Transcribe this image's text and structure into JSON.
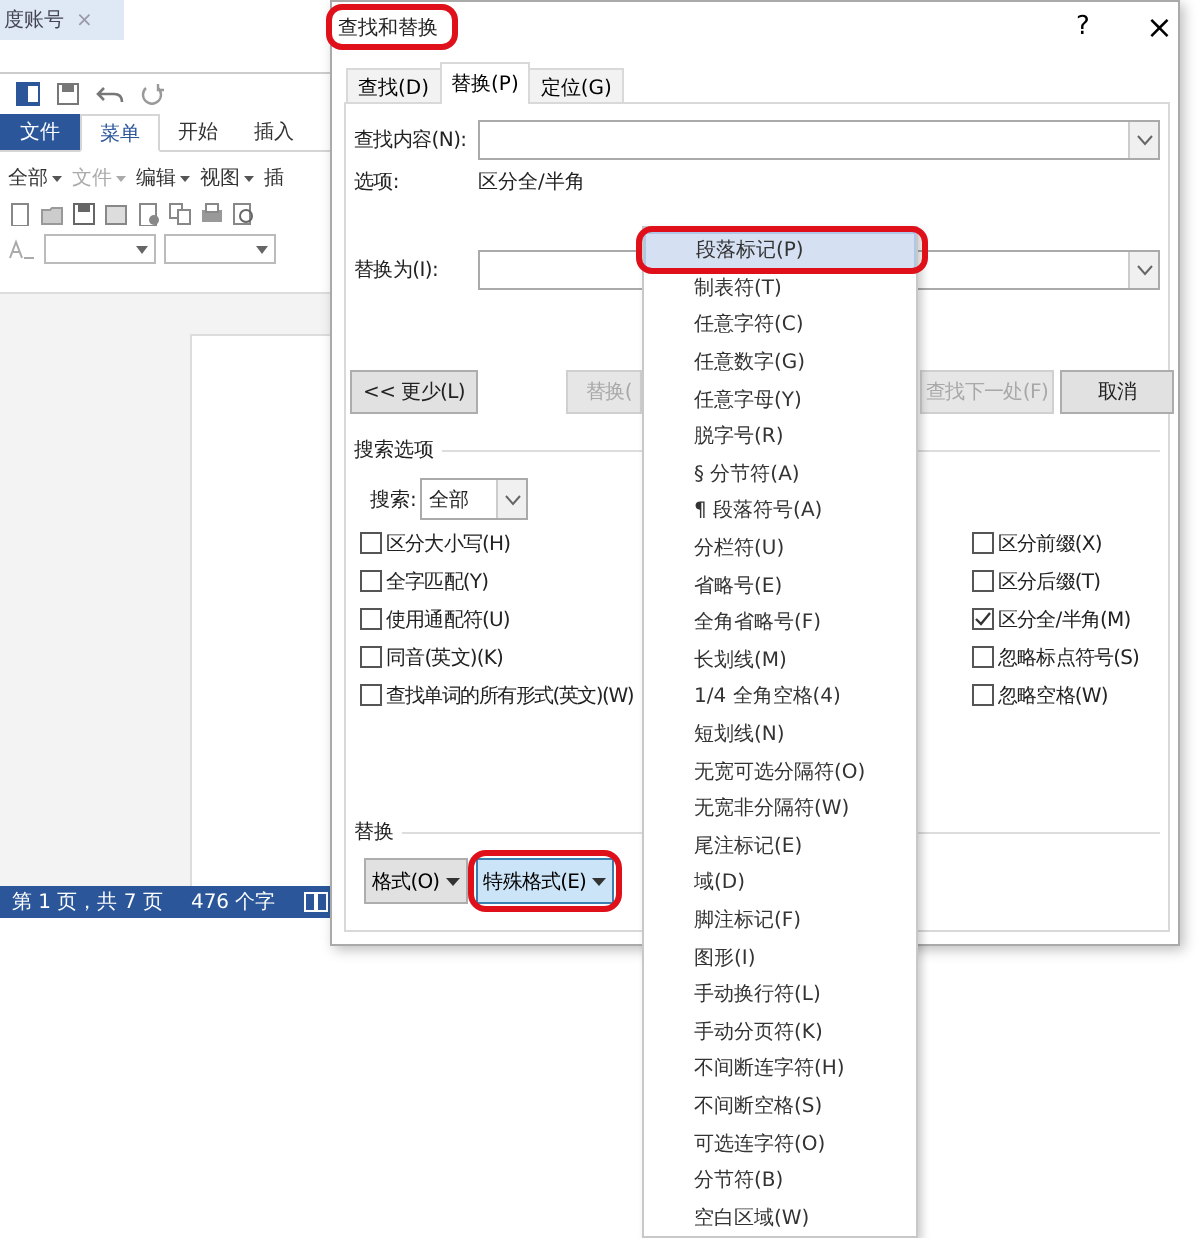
{
  "browser_tab": {
    "title": "度账号",
    "close": "×"
  },
  "word": {
    "tabs": [
      {
        "label": "文件",
        "kind": "file",
        "selected": false
      },
      {
        "label": "菜单",
        "kind": "tab",
        "selected": true
      },
      {
        "label": "开始",
        "kind": "tab",
        "selected": false
      },
      {
        "label": "插入",
        "kind": "tab",
        "selected": false
      }
    ],
    "menus": [
      {
        "label": "全部",
        "disabled": false
      },
      {
        "label": "文件",
        "disabled": true
      },
      {
        "label": "编辑",
        "disabled": false
      },
      {
        "label": "视图",
        "disabled": false
      },
      {
        "label": "插",
        "disabled": false
      }
    ],
    "status": {
      "page": "第 1 页，共 7 页",
      "words": "476 个字"
    }
  },
  "dialog": {
    "title": "查找和替换",
    "help": "?",
    "close": "×",
    "tabs": [
      {
        "label": "查找(D)",
        "selected": false
      },
      {
        "label": "替换(P)",
        "selected": true
      },
      {
        "label": "定位(G)",
        "selected": false
      }
    ],
    "find_label": "查找内容(N):",
    "options_label": "选项:",
    "options_value": "区分全/半角",
    "replace_label": "替换为(I):",
    "buttons": [
      {
        "label": "<< 更少(L)",
        "disabled": false
      },
      {
        "label": "替换(",
        "disabled": true
      },
      {
        "label": "查找下一处(F)",
        "disabled": true
      },
      {
        "label": "取消",
        "disabled": false
      }
    ],
    "search_options_title": "搜索选项",
    "search_label": "搜索:",
    "search_value": "全部",
    "checks_left": [
      {
        "label": "区分大小写(H)",
        "checked": false
      },
      {
        "label": "全字匹配(Y)",
        "checked": false
      },
      {
        "label": "使用通配符(U)",
        "checked": false
      },
      {
        "label": "同音(英文)(K)",
        "checked": false
      },
      {
        "label": "查找单词的所有形式(英文)(W)",
        "checked": false
      }
    ],
    "checks_right": [
      {
        "label": "区分前缀(X)",
        "checked": false
      },
      {
        "label": "区分后缀(T)",
        "checked": false
      },
      {
        "label": "区分全/半角(M)",
        "checked": true
      },
      {
        "label": "忽略标点符号(S)",
        "checked": false
      },
      {
        "label": "忽略空格(W)",
        "checked": false
      }
    ],
    "replace_section": "替换",
    "format_buttons": [
      {
        "label": "格式(O)",
        "selected": false
      },
      {
        "label": "特殊格式(E)",
        "selected": true
      }
    ]
  },
  "special_menu": {
    "items": [
      {
        "label": "段落标记(P)",
        "selected": true
      },
      {
        "label": "制表符(T)",
        "selected": false
      },
      {
        "label": "任意字符(C)",
        "selected": false
      },
      {
        "label": "任意数字(G)",
        "selected": false
      },
      {
        "label": "任意字母(Y)",
        "selected": false
      },
      {
        "label": "脱字号(R)",
        "selected": false
      },
      {
        "label": "§ 分节符(A)",
        "selected": false
      },
      {
        "label": "¶ 段落符号(A)",
        "selected": false
      },
      {
        "label": "分栏符(U)",
        "selected": false
      },
      {
        "label": "省略号(E)",
        "selected": false
      },
      {
        "label": "全角省略号(F)",
        "selected": false
      },
      {
        "label": "长划线(M)",
        "selected": false
      },
      {
        "label": "1/4 全角空格(4)",
        "selected": false
      },
      {
        "label": "短划线(N)",
        "selected": false
      },
      {
        "label": "无宽可选分隔符(O)",
        "selected": false
      },
      {
        "label": "无宽非分隔符(W)",
        "selected": false
      },
      {
        "label": "尾注标记(E)",
        "selected": false
      },
      {
        "label": "域(D)",
        "selected": false
      },
      {
        "label": "脚注标记(F)",
        "selected": false
      },
      {
        "label": "图形(I)",
        "selected": false
      },
      {
        "label": "手动换行符(L)",
        "selected": false
      },
      {
        "label": "手动分页符(K)",
        "selected": false
      },
      {
        "label": "不间断连字符(H)",
        "selected": false
      },
      {
        "label": "不间断空格(S)",
        "selected": false
      },
      {
        "label": "可选连字符(O)",
        "selected": false
      },
      {
        "label": "分节符(B)",
        "selected": false
      },
      {
        "label": "空白区域(W)",
        "selected": false
      }
    ]
  }
}
